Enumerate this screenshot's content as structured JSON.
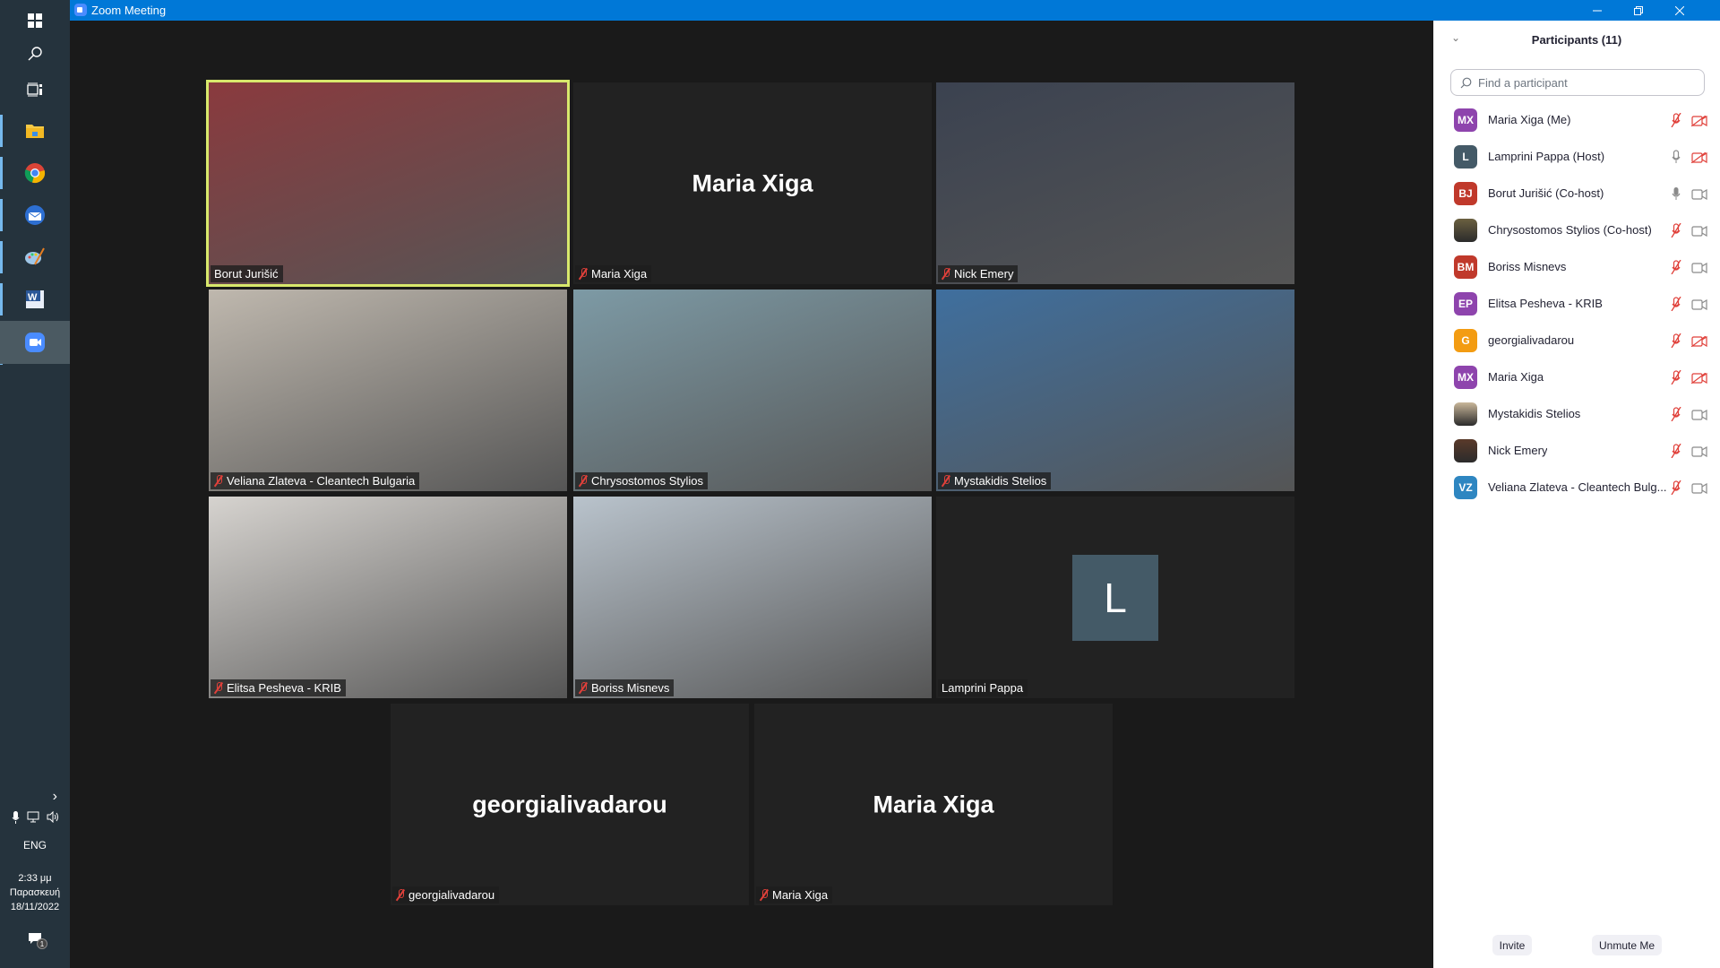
{
  "window": {
    "title": "Zoom Meeting"
  },
  "taskbar": {
    "language": "ENG",
    "time": "2:33 μμ",
    "day": "Παρασκευή",
    "date": "18/11/2022",
    "notification_count": "1"
  },
  "tiles": [
    {
      "name": "Borut Jurišić",
      "big_name": "",
      "muted": false,
      "video": true,
      "active": true,
      "bg": "#8a3a3e"
    },
    {
      "name": "Maria Xiga",
      "big_name": "Maria Xiga",
      "muted": true,
      "video": false,
      "active": false
    },
    {
      "name": "Nick Emery",
      "big_name": "",
      "muted": true,
      "video": true,
      "active": false,
      "bg": "#3b4250"
    },
    {
      "name": "Veliana Zlateva - Cleantech Bulgaria",
      "big_name": "",
      "muted": true,
      "video": true,
      "active": false,
      "bg": "#bfb8ae"
    },
    {
      "name": "Chrysostomos Stylios",
      "big_name": "",
      "muted": true,
      "video": true,
      "active": false,
      "bg": "#7d9aa5"
    },
    {
      "name": "Mystakidis Stelios",
      "big_name": "",
      "muted": true,
      "video": true,
      "active": false,
      "bg": "#3f6f9e"
    },
    {
      "name": "Elitsa Pesheva - KRIB",
      "big_name": "",
      "muted": true,
      "video": true,
      "active": false,
      "bg": "#d6d3cf"
    },
    {
      "name": "Boriss Misnevs",
      "big_name": "",
      "muted": true,
      "video": true,
      "active": false,
      "bg": "#b9c3cc"
    },
    {
      "name": "Lamprini Pappa",
      "big_name": "",
      "avatar_letter": "L",
      "muted": false,
      "video": false,
      "active": false
    },
    {
      "name": "georgialivadarou",
      "big_name": "georgialivadarou",
      "muted": true,
      "video": false,
      "active": false
    },
    {
      "name": "Maria Xiga",
      "big_name": "Maria Xiga",
      "muted": true,
      "video": false,
      "active": false
    }
  ],
  "participants_panel": {
    "title": "Participants (11)",
    "search_placeholder": "Find a participant",
    "invite_label": "Invite",
    "unmute_label": "Unmute Me",
    "participants": [
      {
        "initials": "MX",
        "color": "#8e44ad",
        "name": "Maria Xiga (Me)",
        "mic": "muted",
        "video": "off"
      },
      {
        "initials": "L",
        "color": "#445a67",
        "name": "Lamprini Pappa (Host)",
        "mic": "on",
        "video": "off"
      },
      {
        "initials": "BJ",
        "color": "#c0392b",
        "name": "Borut Jurišić (Co-host)",
        "mic": "active",
        "video": "on"
      },
      {
        "initials": "",
        "color": "#6b6040",
        "name": "Chrysostomos Stylios (Co-host)",
        "mic": "muted",
        "video": "on",
        "photo": true
      },
      {
        "initials": "BM",
        "color": "#c0392b",
        "name": "Boriss Misnevs",
        "mic": "muted",
        "video": "on"
      },
      {
        "initials": "EP",
        "color": "#8e44ad",
        "name": "Elitsa Pesheva - KRIB",
        "mic": "muted",
        "video": "on"
      },
      {
        "initials": "G",
        "color": "#f39c12",
        "name": "georgialivadarou",
        "mic": "muted",
        "video": "off"
      },
      {
        "initials": "MX",
        "color": "#8e44ad",
        "name": "Maria Xiga",
        "mic": "muted",
        "video": "off"
      },
      {
        "initials": "",
        "color": "#c9b79a",
        "name": "Mystakidis Stelios",
        "mic": "muted",
        "video": "on",
        "photo": true
      },
      {
        "initials": "",
        "color": "#5a3a2a",
        "name": "Nick Emery",
        "mic": "muted",
        "video": "on",
        "photo": true
      },
      {
        "initials": "VZ",
        "color": "#2e86c1",
        "name": "Veliana Zlateva - Cleantech Bulg...",
        "mic": "muted",
        "video": "on"
      }
    ]
  }
}
